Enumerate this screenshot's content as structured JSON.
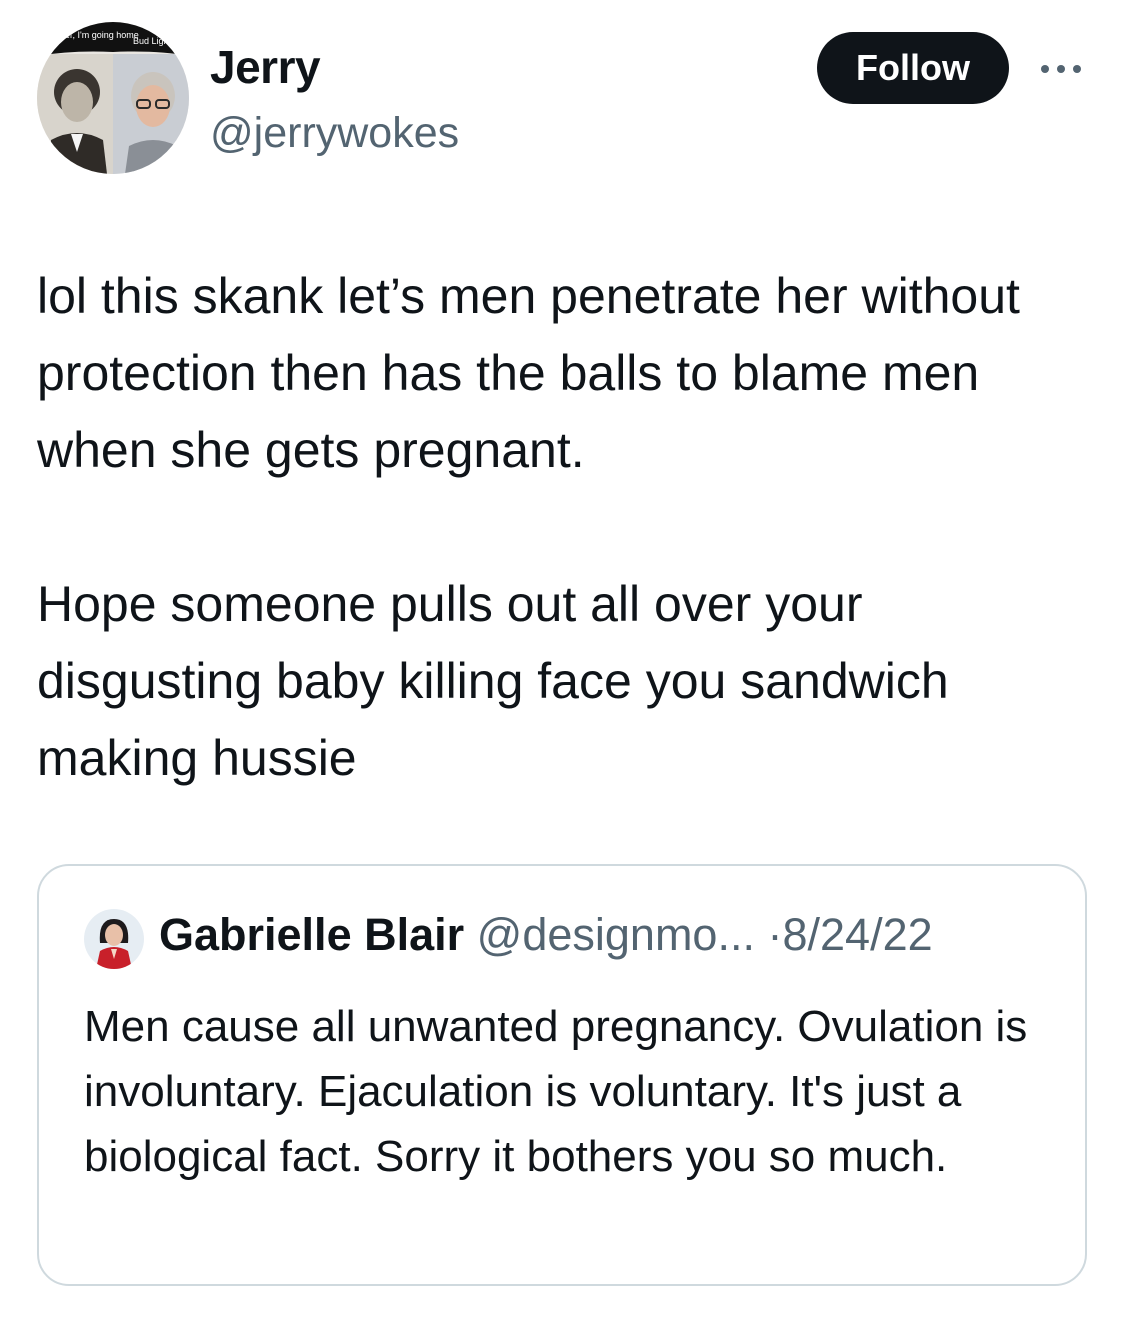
{
  "author": {
    "name": "Jerry",
    "handle": "@jerrywokes",
    "avatar_captions": {
      "left": "beer, I'm going home",
      "right": "Bud Light later"
    }
  },
  "follow_label": "Follow",
  "more_icon": "more-horizontal-icon",
  "tweet": {
    "paragraph1": "lol this skank let’s men penetrate her without protection then has the balls to blame men when she gets pregnant.",
    "paragraph2": "Hope someone pulls out all over your disgusting baby killing face you sandwich making hussie"
  },
  "quote": {
    "name": "Gabrielle Blair",
    "handle": "@designmo...",
    "separator": "·",
    "date": "8/24/22",
    "text": "Men cause all unwanted pregnancy. Ovulation is involuntary. Ejaculation is voluntary. It's just a biological fact. Sorry it bothers you so much."
  },
  "colors": {
    "text": "#0f1419",
    "secondary": "#536471",
    "border": "#cfd9de",
    "button": "#0f1419"
  }
}
